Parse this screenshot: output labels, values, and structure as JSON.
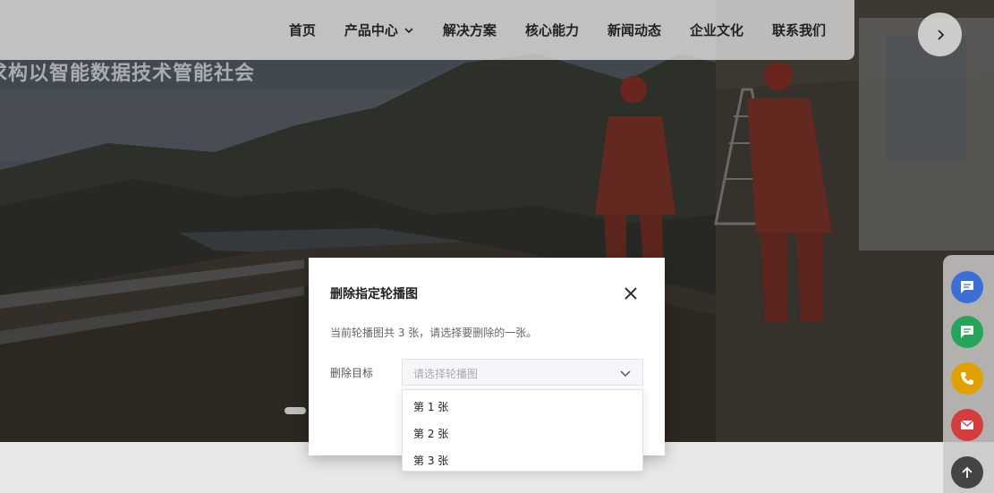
{
  "hero": {
    "caption": "求构以智能数据技术管能社会"
  },
  "nav": {
    "items": [
      {
        "label": "首页"
      },
      {
        "label": "产品中心"
      },
      {
        "label": "解决方案"
      },
      {
        "label": "核心能力"
      },
      {
        "label": "新闻动态"
      },
      {
        "label": "企业文化"
      },
      {
        "label": "联系我们"
      }
    ]
  },
  "side_toolbar": {
    "buttons": [
      {
        "icon": "chat-icon",
        "color": "#3a6fd8"
      },
      {
        "icon": "message-icon",
        "color": "#23a55a"
      },
      {
        "icon": "phone-icon",
        "color": "#e0a000"
      },
      {
        "icon": "mail-icon",
        "color": "#d63c3c"
      },
      {
        "icon": "arrow-up-icon",
        "color": "#444444"
      }
    ]
  },
  "modal": {
    "title": "删除指定轮播图",
    "description": "当前轮播图共 3 张，请选择要删除的一张。",
    "field_label": "删除目标",
    "select_placeholder": "请选择轮播图",
    "options": [
      {
        "label": "第 1 张"
      },
      {
        "label": "第 2 张"
      },
      {
        "label": "第 3 张"
      }
    ]
  },
  "colors": {
    "accent": "#2f7bd8"
  }
}
